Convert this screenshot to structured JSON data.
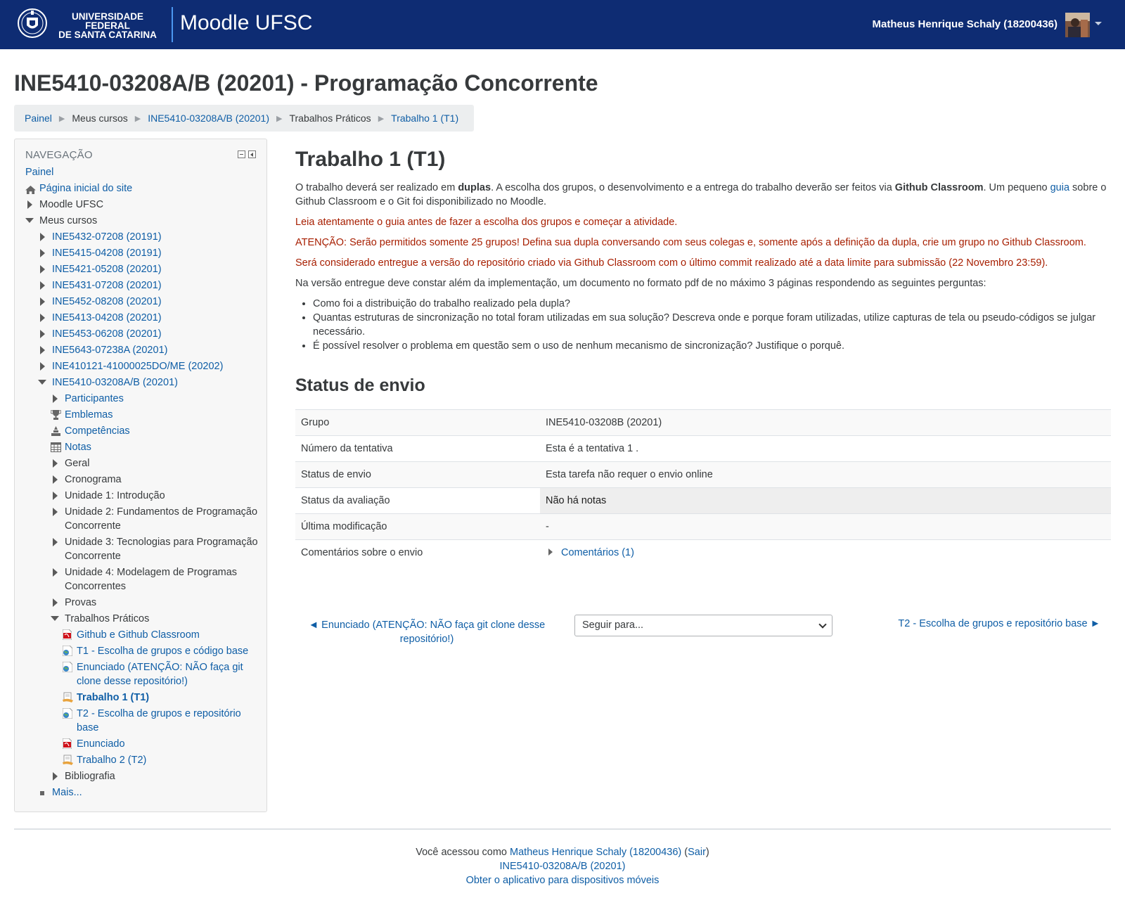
{
  "header": {
    "university_line1": "UNIVERSIDADE FEDERAL",
    "university_line2": "DE SANTA CATARINA",
    "site_name": "Moodle UFSC",
    "user_name": "Matheus Henrique Schaly (18200436)"
  },
  "page": {
    "course_title": "INE5410-03208A/B (20201) - Programação Concorrente"
  },
  "breadcrumb": [
    {
      "label": "Painel",
      "link": true
    },
    {
      "label": "Meus cursos",
      "link": false
    },
    {
      "label": "INE5410-03208A/B (20201)",
      "link": true
    },
    {
      "label": "Trabalhos Práticos",
      "link": false
    },
    {
      "label": "Trabalho 1 (T1)",
      "link": true
    }
  ],
  "sidebar": {
    "title": "NAVEGAÇÃO",
    "items": [
      {
        "label": "Painel",
        "level": 0,
        "icon": "none",
        "style": "link"
      },
      {
        "label": "Página inicial do site",
        "level": 0,
        "icon": "home-icon",
        "style": "link"
      },
      {
        "label": "Moodle UFSC",
        "level": 0,
        "icon": "expand-icon",
        "style": "dark"
      },
      {
        "label": "Meus cursos",
        "level": 0,
        "icon": "collapse-icon",
        "style": "dark"
      },
      {
        "label": "INE5432-07208 (20191)",
        "level": 1,
        "icon": "expand-icon",
        "style": "link"
      },
      {
        "label": "INE5415-04208 (20191)",
        "level": 1,
        "icon": "expand-icon",
        "style": "link"
      },
      {
        "label": "INE5421-05208 (20201)",
        "level": 1,
        "icon": "expand-icon",
        "style": "link"
      },
      {
        "label": "INE5431-07208 (20201)",
        "level": 1,
        "icon": "expand-icon",
        "style": "link"
      },
      {
        "label": "INE5452-08208 (20201)",
        "level": 1,
        "icon": "expand-icon",
        "style": "link"
      },
      {
        "label": "INE5413-04208 (20201)",
        "level": 1,
        "icon": "expand-icon",
        "style": "link"
      },
      {
        "label": "INE5453-06208 (20201)",
        "level": 1,
        "icon": "expand-icon",
        "style": "link"
      },
      {
        "label": "INE5643-07238A (20201)",
        "level": 1,
        "icon": "expand-icon",
        "style": "link"
      },
      {
        "label": "INE410121-41000025DO/ME (20202)",
        "level": 1,
        "icon": "expand-icon",
        "style": "link"
      },
      {
        "label": "INE5410-03208A/B (20201)",
        "level": 1,
        "icon": "collapse-icon",
        "style": "link"
      },
      {
        "label": "Participantes",
        "level": 2,
        "icon": "expand-icon",
        "style": "link"
      },
      {
        "label": "Emblemas",
        "level": 2,
        "icon": "trophy-icon",
        "style": "link"
      },
      {
        "label": "Competências",
        "level": 2,
        "icon": "competency-icon",
        "style": "link"
      },
      {
        "label": "Notas",
        "level": 2,
        "icon": "grades-table-icon",
        "style": "link"
      },
      {
        "label": "Geral",
        "level": 2,
        "icon": "expand-icon",
        "style": "dark"
      },
      {
        "label": "Cronograma",
        "level": 2,
        "icon": "expand-icon",
        "style": "dark"
      },
      {
        "label": "Unidade 1: Introdução",
        "level": 2,
        "icon": "expand-icon",
        "style": "dark"
      },
      {
        "label": "Unidade 2: Fundamentos de Programação Concorrente",
        "level": 2,
        "icon": "expand-icon",
        "style": "dark",
        "multi": true
      },
      {
        "label": "Unidade 3: Tecnologias para Programação Concorrente",
        "level": 2,
        "icon": "expand-icon",
        "style": "dark",
        "multi": true
      },
      {
        "label": "Unidade 4: Modelagem de Programas Concorrentes",
        "level": 2,
        "icon": "expand-icon",
        "style": "dark",
        "multi": true
      },
      {
        "label": "Provas",
        "level": 2,
        "icon": "expand-icon",
        "style": "dark"
      },
      {
        "label": "Trabalhos Práticos",
        "level": 2,
        "icon": "collapse-icon",
        "style": "dark"
      },
      {
        "label": "Github e Github Classroom",
        "level": 3,
        "icon": "pdf-icon",
        "style": "link"
      },
      {
        "label": "T1 - Escolha de grupos e código base",
        "level": 3,
        "icon": "url-icon",
        "style": "link"
      },
      {
        "label": "Enunciado (ATENÇÃO: NÃO faça git clone desse repositório!)",
        "level": 3,
        "icon": "url-icon",
        "style": "link",
        "multi": true
      },
      {
        "label": "Trabalho 1 (T1)",
        "level": 3,
        "icon": "assignment-icon",
        "style": "active"
      },
      {
        "label": "T2 - Escolha de grupos e repositório base",
        "level": 3,
        "icon": "url-icon",
        "style": "link",
        "multi": true
      },
      {
        "label": "Enunciado",
        "level": 3,
        "icon": "pdf-icon",
        "style": "link"
      },
      {
        "label": "Trabalho 2 (T2)",
        "level": 3,
        "icon": "assignment-icon",
        "style": "link"
      },
      {
        "label": "Bibliografia",
        "level": 2,
        "icon": "expand-icon",
        "style": "dark"
      },
      {
        "label": "Mais...",
        "level": 1,
        "icon": "bullet-icon",
        "style": "link"
      }
    ]
  },
  "activity": {
    "title": "Trabalho 1 (T1)",
    "p1_a": "O trabalho deverá ser realizado em ",
    "p1_b": "duplas",
    "p1_c": ". A escolha dos grupos, o desenvolvimento e a entrega do trabalho deverão ser feitos via ",
    "p1_d": "Github Classroom",
    "p1_e": ". Um pequeno ",
    "p1_link": "guia",
    "p1_f": " sobre o Github Classroom e o Git foi disponibilizado no Moodle.",
    "warn1": "Leia atentamente o guia antes de fazer a escolha dos grupos e começar a atividade.",
    "warn2": "ATENÇÃO: Serão permitidos somente 25 grupos! Defina sua dupla conversando com seus colegas e, somente após a definição da dupla, crie um grupo no Github Classroom.",
    "warn3": "Será considerado entregue a versão do repositório criado via Github Classroom com o último commit realizado até a data limite para submissão (22 Novembro 23:59).",
    "p_list_intro": "Na versão entregue deve constar além da implementação, um documento no formato pdf de no máximo 3 páginas respondendo as seguintes perguntas:",
    "questions": [
      "Como foi a distribuição do trabalho realizado pela dupla?",
      "Quantas estruturas de sincronização no total foram utilizadas em sua solução? Descreva onde e porque foram utilizadas, utilize capturas de tela ou pseudo-códigos se julgar necessário.",
      "É possível resolver o problema em questão sem o uso de nenhum mecanismo de sincronização? Justifique o porquê."
    ]
  },
  "status": {
    "heading": "Status de envio",
    "rows": [
      {
        "label": "Grupo",
        "value": "INE5410-03208B (20201)"
      },
      {
        "label": "Número da tentativa",
        "value": "Esta é a tentativa 1 ."
      },
      {
        "label": "Status de envio",
        "value": "Esta tarefa não requer o envio online"
      },
      {
        "label": "Status da avaliação",
        "value": "Não há notas"
      },
      {
        "label": "Última modificação",
        "value": "-"
      },
      {
        "label": "Comentários sobre o envio",
        "value": "Comentários (1)"
      }
    ]
  },
  "activity_nav": {
    "prev": "◄ Enunciado (ATENÇÃO: NÃO faça git clone desse repositório!)",
    "jump_selected": "Seguir para...",
    "next": "T2 - Escolha de grupos e repositório base ►"
  },
  "footer": {
    "logged_as": "Você acessou como ",
    "user_link": "Matheus Henrique Schaly (18200436)",
    "logout_open": " (",
    "logout": "Sair",
    "logout_close": ")",
    "course_link": "INE5410-03208A/B (20201)",
    "app_link": "Obter o aplicativo para dispositivos móveis"
  }
}
